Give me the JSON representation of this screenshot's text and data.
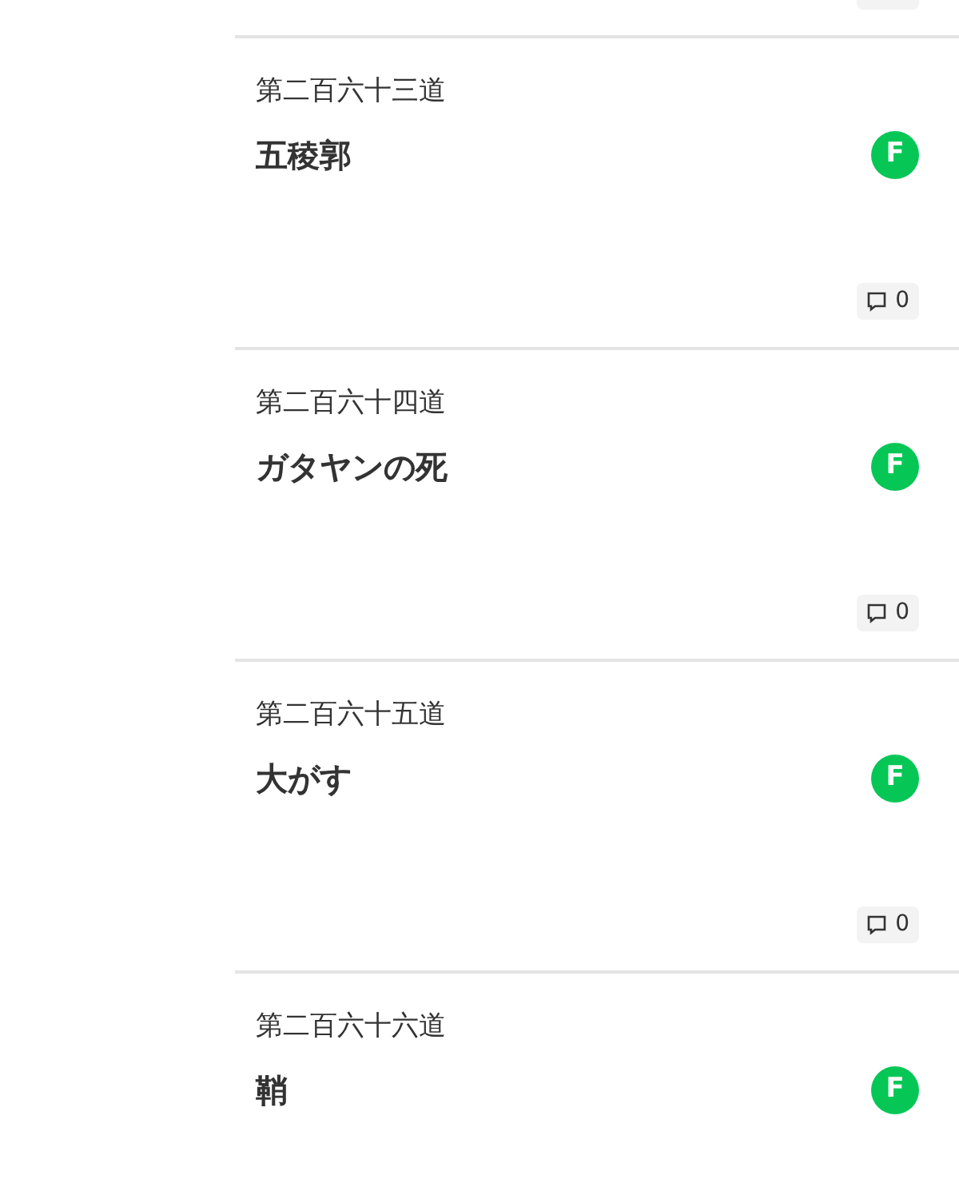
{
  "episodes": [
    {
      "number": "第二百六十三道",
      "title": "五稜郭",
      "badge": "F",
      "comments": "0"
    },
    {
      "number": "第二百六十四道",
      "title": "ガタヤンの死",
      "badge": "F",
      "comments": "0"
    },
    {
      "number": "第二百六十五道",
      "title": "大がす",
      "badge": "F",
      "comments": "0"
    },
    {
      "number": "第二百六十六道",
      "title": "鞘",
      "badge": "F"
    }
  ]
}
